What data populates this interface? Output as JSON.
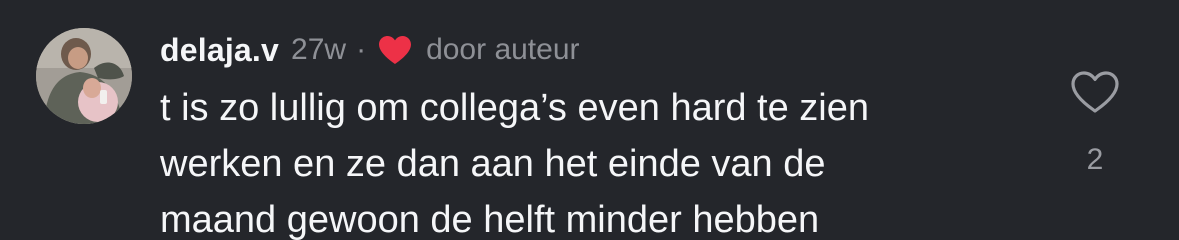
{
  "comment": {
    "username": "delaja.v",
    "time": "27w",
    "separator": "·",
    "liked_by_author_label": "door auteur",
    "text_lines": [
      "t is zo lullig om collega’s even hard te zien",
      "werken en ze dan aan het einde van de",
      "maand gewoon de helft minder hebben"
    ],
    "like_count": "2"
  },
  "icons": {
    "author_heart": "heart-filled-icon",
    "like_button": "heart-outline-icon"
  },
  "colors": {
    "background": "#24262b",
    "heart_red": "#ed3147",
    "muted_text": "#8e9096"
  }
}
